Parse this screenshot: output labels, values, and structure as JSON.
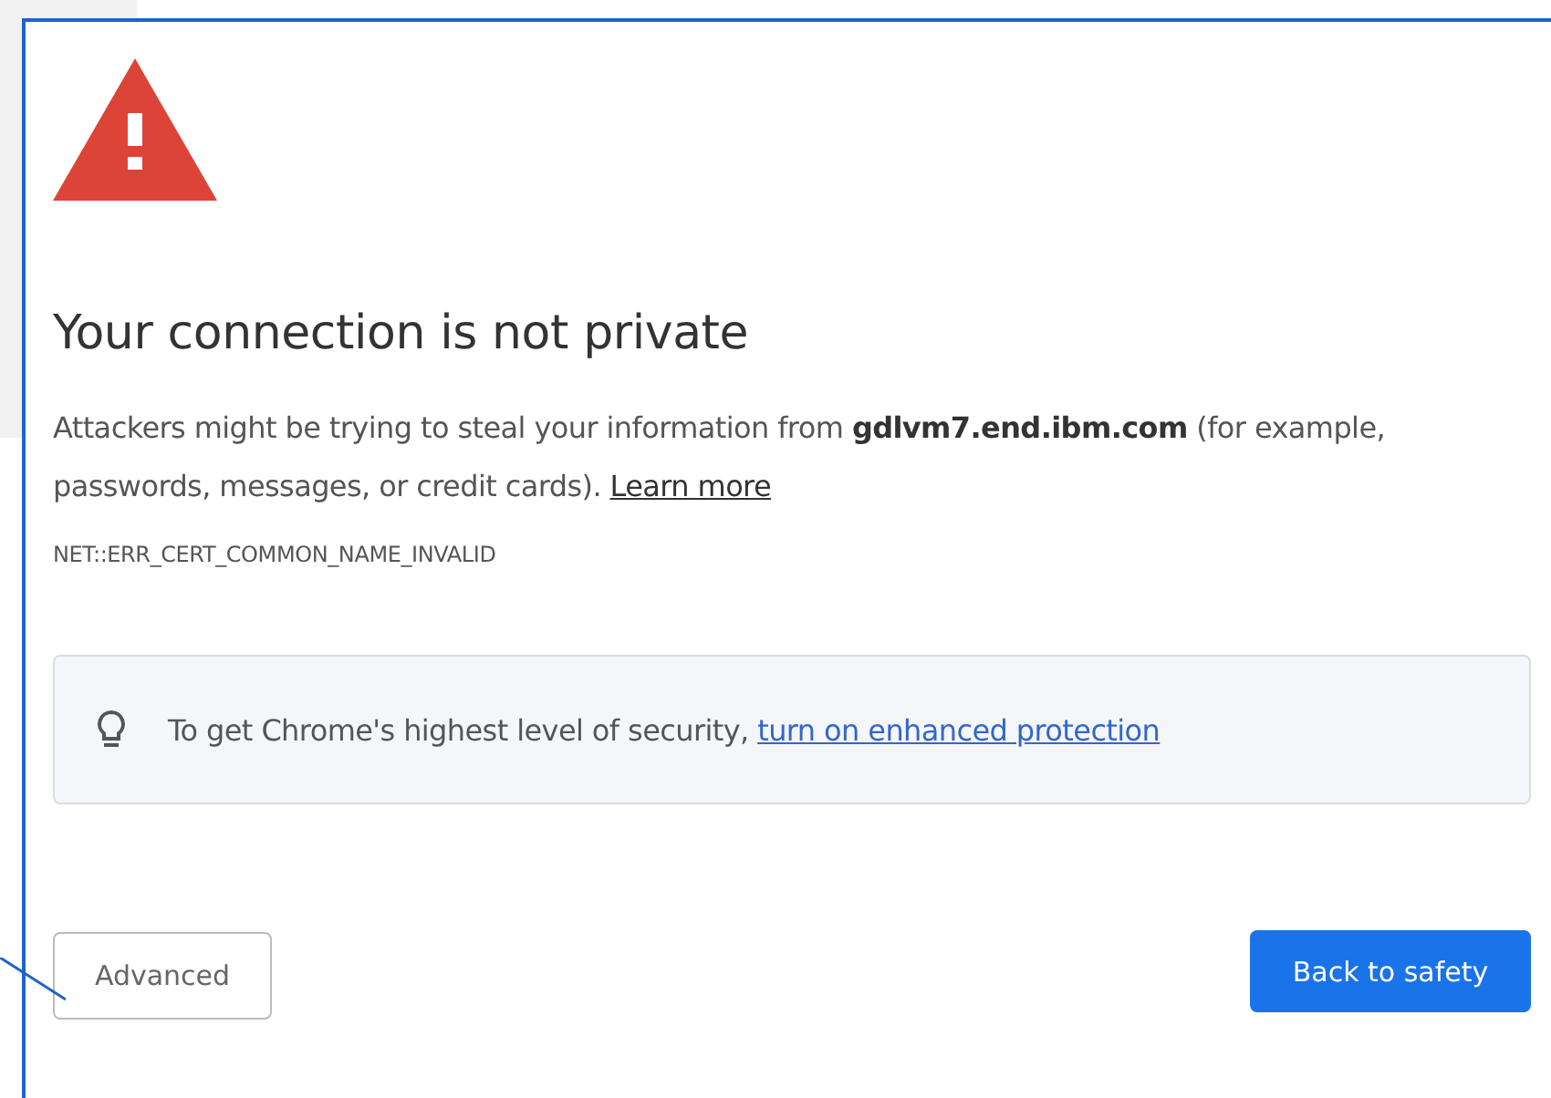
{
  "heading": "Your connection is not private",
  "message": {
    "before": "Attackers might be trying to steal your information from **gdlvm7.end.ibm.com** (for example, passwords, messages, or credit cards). ",
    "link": "Learn more"
  },
  "error_code": "NET::ERR_CERT_COMMON_NAME_INVALID",
  "tip": {
    "text": "To get Chrome's highest level of security, ",
    "link": "turn on enhanced protection"
  },
  "buttons": [
    {
      "label": "Advanced",
      "kind": "secondary"
    },
    {
      "label": "Back to safety",
      "kind": "primary"
    }
  ]
}
